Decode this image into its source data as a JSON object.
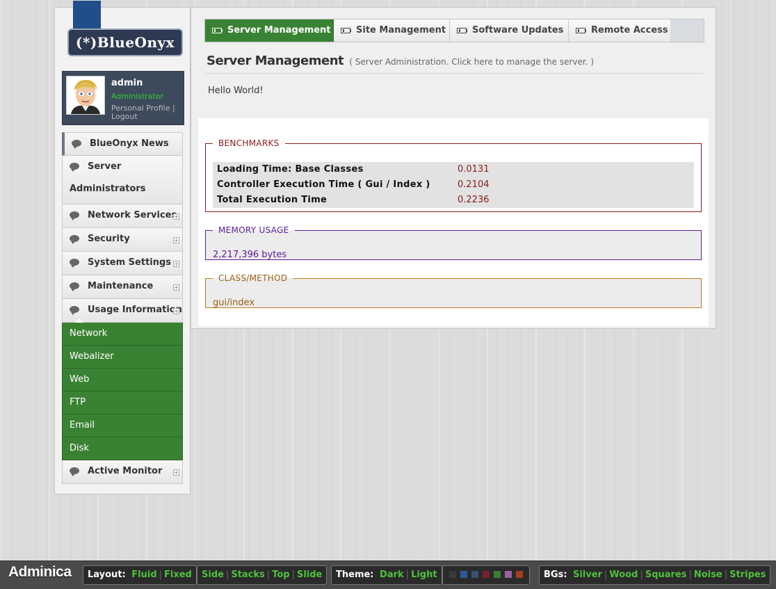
{
  "sidebar": {
    "logo_text": "(*)BlueOnyx",
    "user": {
      "name": "admin",
      "role": "Administrator",
      "profile_link": "Personal Profile",
      "separator": "|",
      "logout_link": "Logout"
    },
    "nav": [
      {
        "label": "BlueOnyx News",
        "expandable": false
      },
      {
        "label": "Server",
        "label2": "Administrators",
        "expandable": false
      },
      {
        "label": "Network Services",
        "expandable": true
      },
      {
        "label": "Security",
        "expandable": true
      },
      {
        "label": "System Settings",
        "expandable": true
      },
      {
        "label": "Maintenance",
        "expandable": true
      },
      {
        "label": "Usage Information",
        "expandable": true
      },
      {
        "label": "Active Monitor",
        "expandable": true
      }
    ],
    "usage_subitems": [
      "Network",
      "Webalizer",
      "Web",
      "FTP",
      "Email",
      "Disk"
    ],
    "expand_glyph": "+"
  },
  "tabs": [
    {
      "label": "Server Management",
      "active": true
    },
    {
      "label": "Site Management",
      "active": false
    },
    {
      "label": "Software Updates",
      "active": false
    },
    {
      "label": "Remote Access",
      "active": false
    }
  ],
  "page": {
    "title": "Server Management",
    "subtitle": "( Server Administration. Click here to manage the server. )",
    "body_text": "Hello World!"
  },
  "debug": {
    "benchmarks": {
      "legend": "BENCHMARKS",
      "rows": [
        {
          "name": "Loading Time: Base Classes",
          "value": "0.0131"
        },
        {
          "name": "Controller Execution Time ( Gui / Index )",
          "value": "0.2104"
        },
        {
          "name": "Total Execution Time",
          "value": "0.2236"
        }
      ]
    },
    "memory": {
      "legend": "MEMORY USAGE",
      "value": "2,217,396 bytes"
    },
    "class_method": {
      "legend": "CLASS/METHOD",
      "value": "gui/index"
    }
  },
  "bottombar": {
    "brand": "Adminica",
    "layout": {
      "label": "Layout:",
      "options": [
        "Fluid",
        "Fixed"
      ]
    },
    "nav_style": {
      "options": [
        "Side",
        "Stacks",
        "Top",
        "Slide"
      ]
    },
    "theme": {
      "label": "Theme:",
      "options": [
        "Dark",
        "Light"
      ]
    },
    "colors": [
      "#3a3a3a",
      "#2a5a9a",
      "#3a5070",
      "#7a2030",
      "#3a8033",
      "#9a60a0",
      "#a04020"
    ],
    "backgrounds": {
      "label": "BGs:",
      "options": [
        "Silver",
        "Wood",
        "Squares",
        "Noise",
        "Stripes"
      ]
    },
    "separator": "|"
  },
  "colors": {
    "accent_green": "#3a8233",
    "benchmark_red": "#8a1a1a",
    "memory_purple": "#5a1a9a",
    "class_orange": "#9a6010"
  }
}
